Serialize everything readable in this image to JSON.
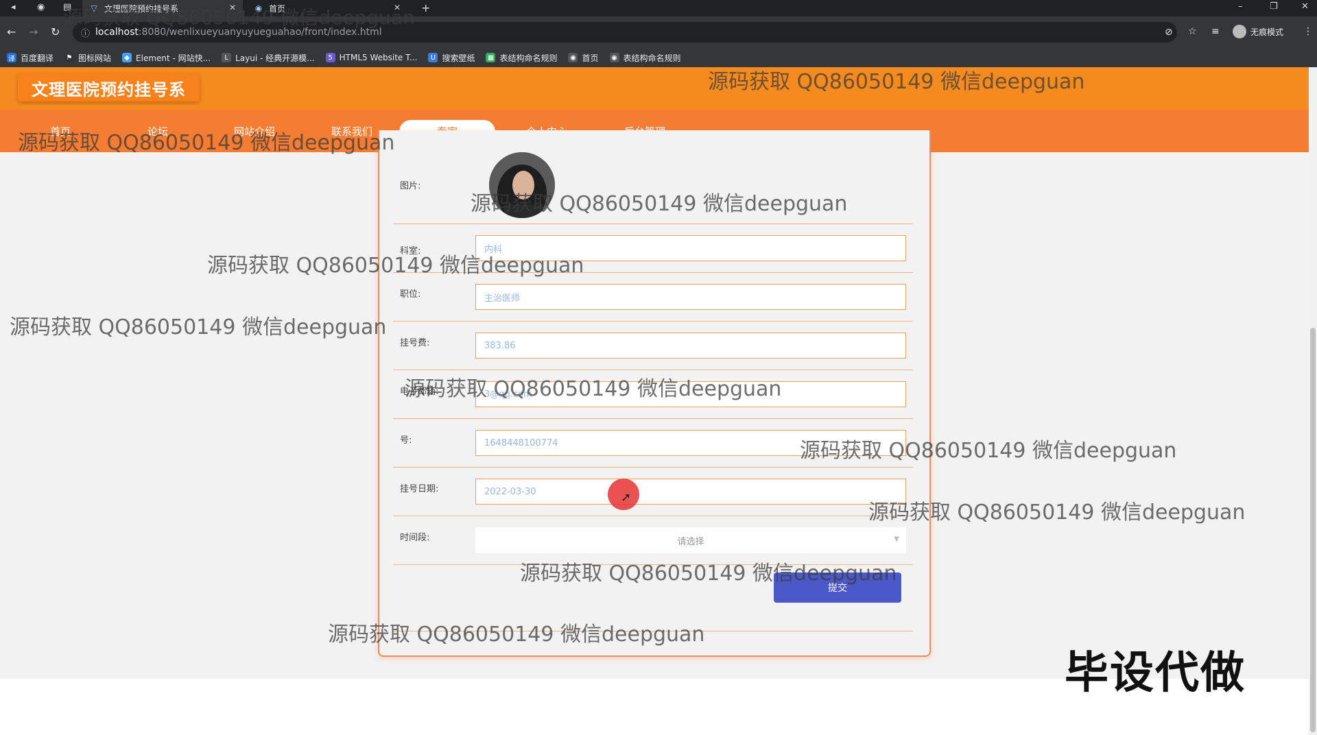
{
  "browser": {
    "tabs": [
      {
        "title": "文理医院预约挂号系",
        "active": true
      },
      {
        "title": "首页",
        "active": false
      }
    ],
    "url_host": "localhost",
    "url_path": ":8080/wenlixueyuanyuyueguahao/front/index.html",
    "incognito_label": "无痕模式",
    "bookmarks": [
      {
        "label": "百度翻译",
        "color": "#1e6fe0"
      },
      {
        "label": "图标网站",
        "color": "#333333"
      },
      {
        "label": "Element - 网站快...",
        "color": "#409eff"
      },
      {
        "label": "Layui - 经典开源模...",
        "color": "#555555"
      },
      {
        "label": "HTML5 Website T...",
        "color": "#6a5acd"
      },
      {
        "label": "搜索壁纸",
        "color": "#3a7bd5"
      },
      {
        "label": "表结构命名规则",
        "color": "#2eaa5a"
      },
      {
        "label": "首页",
        "color": "#555555"
      },
      {
        "label": "表结构命名规则",
        "color": "#555555"
      }
    ]
  },
  "site": {
    "brand": "文理医院预约挂号系",
    "nav": [
      {
        "label": "首页",
        "active": false
      },
      {
        "label": "论坛",
        "active": false
      },
      {
        "label": "网站介绍",
        "active": false
      },
      {
        "label": "联系我们",
        "active": false
      },
      {
        "label": "专家",
        "active": true
      },
      {
        "label": "个人中心",
        "active": false
      },
      {
        "label": "后台管理",
        "active": false
      }
    ]
  },
  "form": {
    "image_label": "图片:",
    "department_label": "科室:",
    "department_value": "内科",
    "position_label": "职位:",
    "position_value": "主治医师",
    "fee_label": "挂号费:",
    "fee_value": "383.86",
    "email_label": "电子邮箱:",
    "email_value": "3@qq.com",
    "number_label": "号:",
    "number_value": "1648448100774",
    "date_label": "挂号日期:",
    "date_value": "2022-03-30",
    "timeslot_label": "时间段:",
    "timeslot_placeholder": "请选择",
    "submit_label": "提交"
  },
  "watermarks": [
    "源码获取 QQ86050149 微信deepguan",
    "源码获取 QQ86050149 微信deepguan",
    "源码获取 QQ86050149 微信deepguan",
    "源码获取 QQ86050149 微信deepguan",
    "源码获取 QQ86050149 微信deepguan",
    "源码获取 QQ86050149 微信deepguan",
    "源码获取 QQ86050149 微信deepguan",
    "源码获取 QQ86050149 微信deepguan",
    "源码获取 QQ86050149 微信deepguan",
    "源码获取 QQ86050149 微信deepguan"
  ],
  "stamp": "毕设代做"
}
